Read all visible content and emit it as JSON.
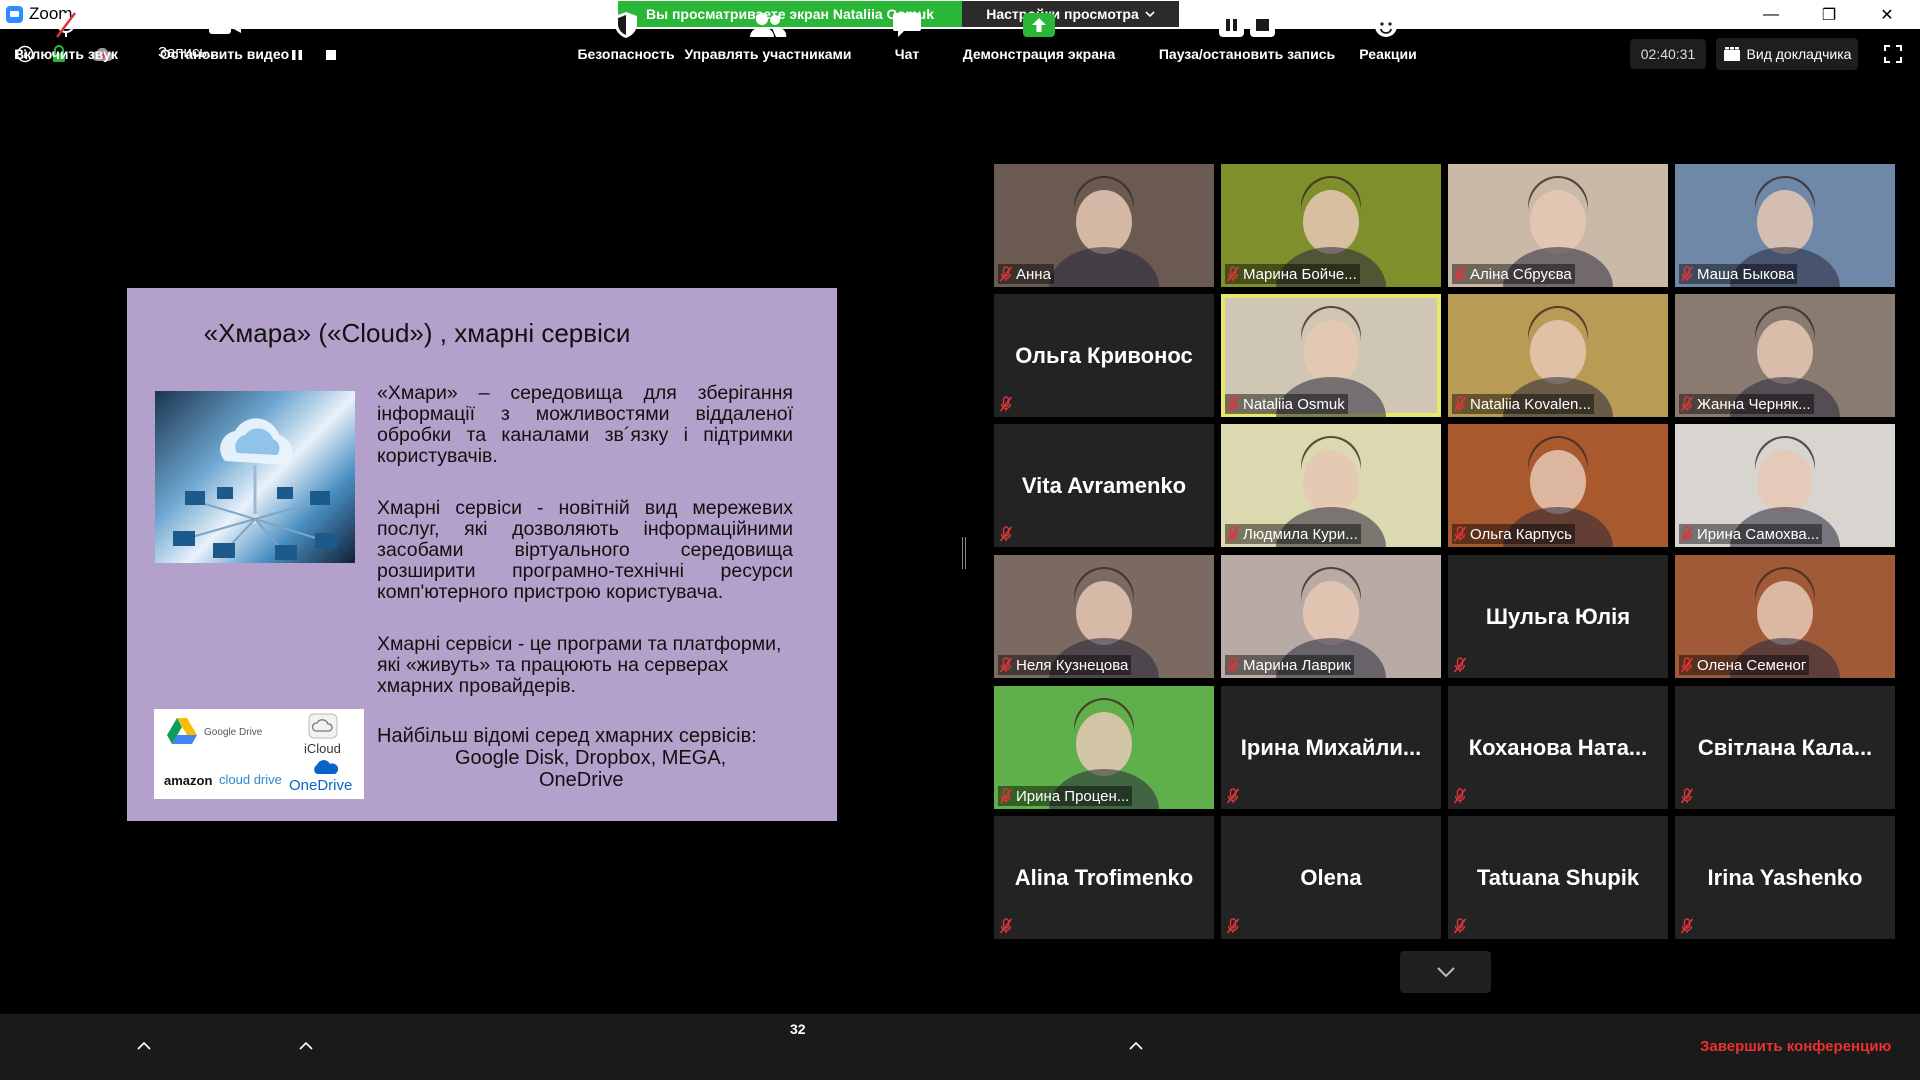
{
  "window": {
    "app_title": "Zoom",
    "share_banner": "Вы просматриваете экран Nataliia Osmuk",
    "view_options": "Настройки просмотра",
    "minimize_glyph": "—",
    "restore_glyph": "❐",
    "close_glyph": "✕"
  },
  "topbar": {
    "recording_label": "Запись...",
    "timer": "02:40:31",
    "speaker_view_label": "Вид докладчика"
  },
  "slide": {
    "title": "«Хмара» («Cloud») , хмарні сервіси",
    "para1": "«Хмари» – середовища для зберігання інформації з можливостями віддаленої обробки та каналами зв´язку і підтримки користувачів.",
    "para2": "Хмарні сервіси - новітній вид мережевих послуг, які дозволяють інформаційними засобами віртуального середовища розширити програмно-технічні ресурси комп'ютерного пристрою користувача.",
    "para3": "Хмарні сервіси - це програми та платформи, які «живуть» та працюють на серверах хмарних провайдерів.",
    "para4_line1": "Найбільш відомі серед хмарних сервісів:",
    "para4_line2": "Google Disk, Dropbox, MEGA,",
    "para4_line3": "OneDrive",
    "logos": {
      "google_drive": "Google Drive",
      "icloud": "iCloud",
      "amazon": "amazon",
      "amazon_cloud": "cloud drive",
      "onedrive": "OneDrive"
    }
  },
  "participants": [
    {
      "name": "Анна",
      "video": true,
      "bg": "#6b5a52"
    },
    {
      "name": "Марина Бойче...",
      "video": true,
      "bg": "#7f8f2c"
    },
    {
      "name": "Аліна Сбруєва",
      "video": true,
      "bg": "#c9b9a6"
    },
    {
      "name": "Маша Быкова",
      "video": true,
      "bg": "#6f88a8"
    },
    {
      "name": "Ольга Кривонос",
      "video": false
    },
    {
      "name": "Nataliia Osmuk",
      "video": true,
      "bg": "#cfc6b4",
      "active": true
    },
    {
      "name": "Nataliia Kovalen...",
      "video": true,
      "bg": "#b89b55"
    },
    {
      "name": "Жанна Черняк...",
      "video": true,
      "bg": "#8a7b70"
    },
    {
      "name": "Vita Avramenko",
      "video": false
    },
    {
      "name": "Людмила Кури...",
      "video": true,
      "bg": "#dcd8b0"
    },
    {
      "name": "Ольга Карпусь",
      "video": true,
      "bg": "#a85a2e"
    },
    {
      "name": "Ирина Самохва...",
      "video": true,
      "bg": "#d8d4cf"
    },
    {
      "name": "Неля Кузнецова",
      "video": true,
      "bg": "#7a6a62"
    },
    {
      "name": "Марина Лаврик",
      "video": true,
      "bg": "#b8aaa4"
    },
    {
      "name": "Шульга Юлія",
      "video": false
    },
    {
      "name": "Олена Семеног",
      "video": true,
      "bg": "#a05a38"
    },
    {
      "name": "Ирина Процен...",
      "video": true,
      "bg": "#5fb04a"
    },
    {
      "name": "Ірина Михайли...",
      "video": false,
      "no_label": true
    },
    {
      "name": "Коханова Ната...",
      "video": false,
      "no_label": true
    },
    {
      "name": "Світлана Кала...",
      "video": false,
      "no_label": true
    },
    {
      "name": "Alina Trofimenko",
      "video": false,
      "no_label": true
    },
    {
      "name": "Olena",
      "video": false,
      "no_label": true
    },
    {
      "name": "Tatuana Shupik",
      "video": false,
      "no_label": true
    },
    {
      "name": "Irina Yashenko",
      "video": false,
      "no_label": true
    }
  ],
  "toolbar": {
    "unmute_label": "Включить звук",
    "stop_video_label": "Остановить видео",
    "security_label": "Безопасность",
    "participants_label": "Управлять участниками",
    "participants_count": "32",
    "chat_label": "Чат",
    "share_label": "Демонстрация экрана",
    "record_label": "Пауза/остановить запись",
    "reactions_label": "Реакции",
    "end_label": "Завершить конференцию"
  },
  "colors": {
    "share_green": "#2ab738",
    "end_red": "#e8322f",
    "active_speaker": "#e7e76a",
    "slide_bg": "#b3a1cb",
    "mic_red": "#e0343b"
  }
}
